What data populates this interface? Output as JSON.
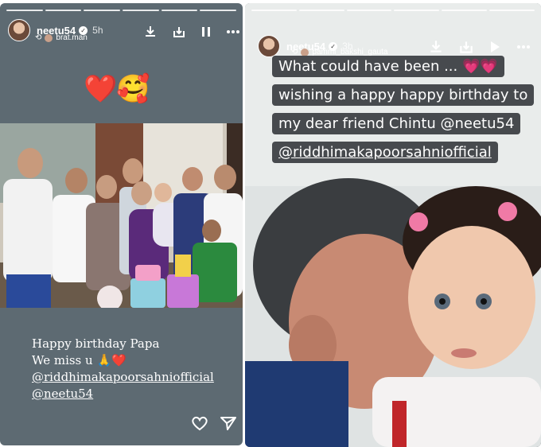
{
  "left_story": {
    "username": "neetu54",
    "time": "5h",
    "reshared_from": "brat.man",
    "emojis": [
      "❤️",
      "🥰"
    ],
    "caption": {
      "line1": "Happy birthday Papa",
      "line2": "We miss u 🙏❤️",
      "tag1": "@riddhimakapoorsahniofficial",
      "tag2": "@neetu54"
    }
  },
  "right_story": {
    "username": "neetu54",
    "time": "3h",
    "reshared_from": "pammi_bakshi_gauta",
    "caption": {
      "line1": "What could have been ... 💗💗",
      "line2": "wishing  a happy happy birthday to",
      "line3": "my dear friend Chintu @neetu54",
      "line4": "@riddhimakapoorsahniofficial"
    }
  },
  "colors": {
    "left_bg": "#5d6a72",
    "right_bg": "#1c1f22",
    "caption_bg": "#474a4e"
  },
  "icons": [
    "download-icon",
    "save-icon",
    "pause-icon",
    "more-icon",
    "play-icon",
    "heart-icon",
    "send-icon",
    "verified-icon"
  ]
}
